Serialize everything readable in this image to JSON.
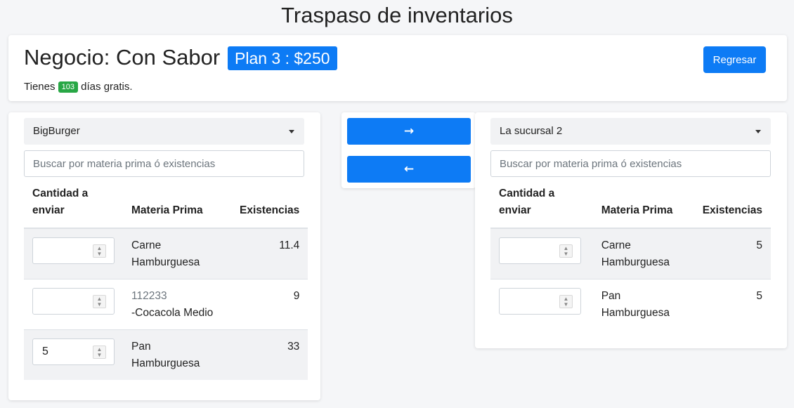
{
  "page": {
    "title": "Traspaso de inventarios"
  },
  "header": {
    "business_label": "Negocio: Con Sabor",
    "plan_label": "Plan 3 : $250",
    "free_prefix": "Tienes",
    "free_days": "103",
    "free_suffix": "días gratis.",
    "back_label": "Regresar"
  },
  "transfer": {
    "right_arrow": "→",
    "left_arrow": "←"
  },
  "left": {
    "branch": "BigBurger",
    "search_placeholder": "Buscar por materia prima ó existencias",
    "headers": {
      "qty": "Cantidad a enviar",
      "item": "Materia Prima",
      "stock": "Existencias"
    },
    "rows": [
      {
        "qty": "",
        "code": "",
        "name": "Carne Hamburguesa",
        "stock": "11.4"
      },
      {
        "qty": "",
        "code": "112233",
        "name": "-Cocacola Medio",
        "stock": "9"
      },
      {
        "qty": "5",
        "code": "",
        "name": "Pan Hamburguesa",
        "stock": "33"
      }
    ]
  },
  "right": {
    "branch": "La sucursal 2",
    "search_placeholder": "Buscar por materia prima ó existencias",
    "headers": {
      "qty": "Cantidad a enviar",
      "item": "Materia Prima",
      "stock": "Existencias"
    },
    "rows": [
      {
        "qty": "",
        "code": "",
        "name": "Carne Hamburguesa",
        "stock": "5"
      },
      {
        "qty": "",
        "code": "",
        "name": "Pan Hamburguesa",
        "stock": "5"
      }
    ]
  },
  "colors": {
    "primary": "#0d7bf5",
    "success": "#28a745",
    "stripe": "#f1f2f4"
  }
}
